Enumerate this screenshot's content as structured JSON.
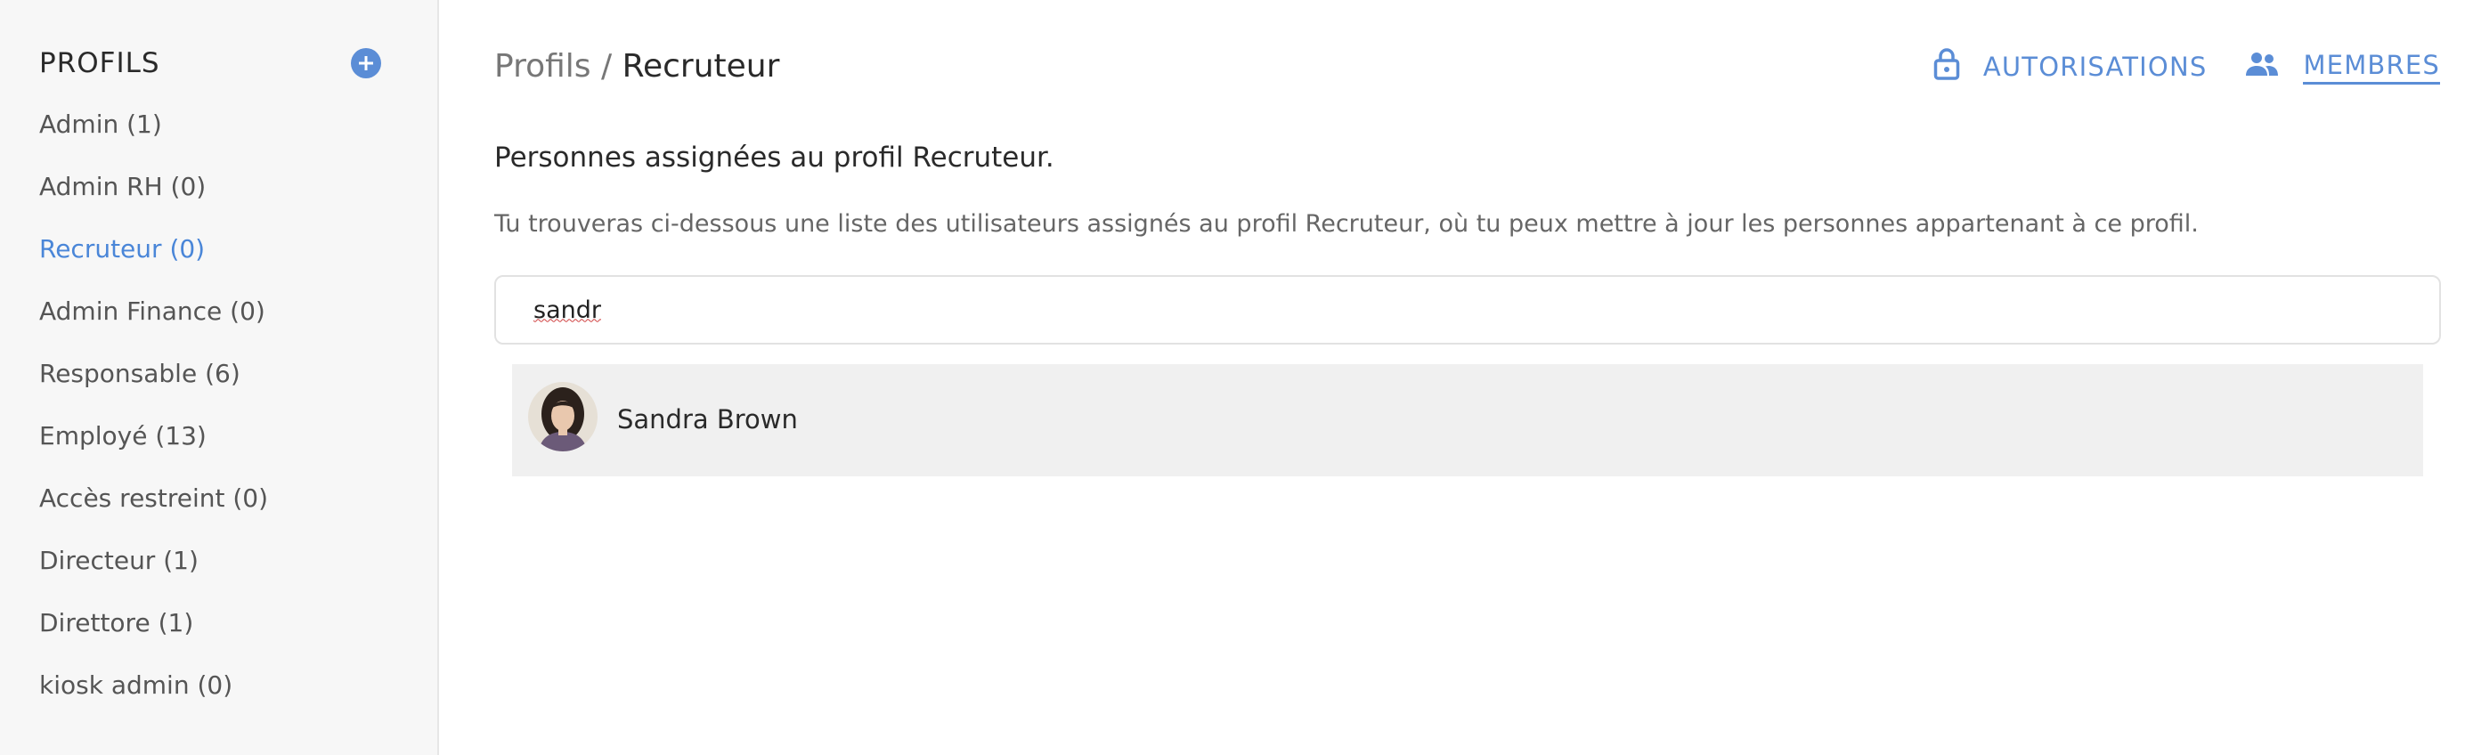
{
  "sidebar": {
    "title": "PROFILS",
    "add_icon": "plus-circle-icon",
    "items": [
      {
        "label": "Admin (1)",
        "active": false
      },
      {
        "label": "Admin RH (0)",
        "active": false
      },
      {
        "label": "Recruteur (0)",
        "active": true
      },
      {
        "label": "Admin Finance (0)",
        "active": false
      },
      {
        "label": "Responsable (6)",
        "active": false
      },
      {
        "label": "Employé (13)",
        "active": false
      },
      {
        "label": "Accès restreint (0)",
        "active": false
      },
      {
        "label": "Directeur (1)",
        "active": false
      },
      {
        "label": "Direttore (1)",
        "active": false
      },
      {
        "label": "kiosk admin (0)",
        "active": false
      }
    ]
  },
  "header": {
    "breadcrumb_root": "Profils",
    "breadcrumb_separator": " / ",
    "breadcrumb_current": "Recruteur"
  },
  "tabs": {
    "permissions": {
      "label": "AUTORISATIONS",
      "icon": "lock-icon",
      "active": false
    },
    "members": {
      "label": "MEMBRES",
      "icon": "people-icon",
      "active": true
    }
  },
  "content": {
    "title": "Personnes assignées au profil Recruteur.",
    "description": "Tu trouveras ci-dessous une liste des utilisateurs assignés au profil Recruteur, où tu peux mettre à jour les personnes appartenant à ce profil."
  },
  "search": {
    "value": "sandr",
    "placeholder": ""
  },
  "results": [
    {
      "name": "Sandra Brown",
      "avatar": "user-photo"
    }
  ],
  "colors": {
    "accent": "#5b8dd6",
    "active_text": "#4a86d8",
    "sidebar_bg": "#f7f7f7",
    "result_bg": "#f0f0f0"
  }
}
